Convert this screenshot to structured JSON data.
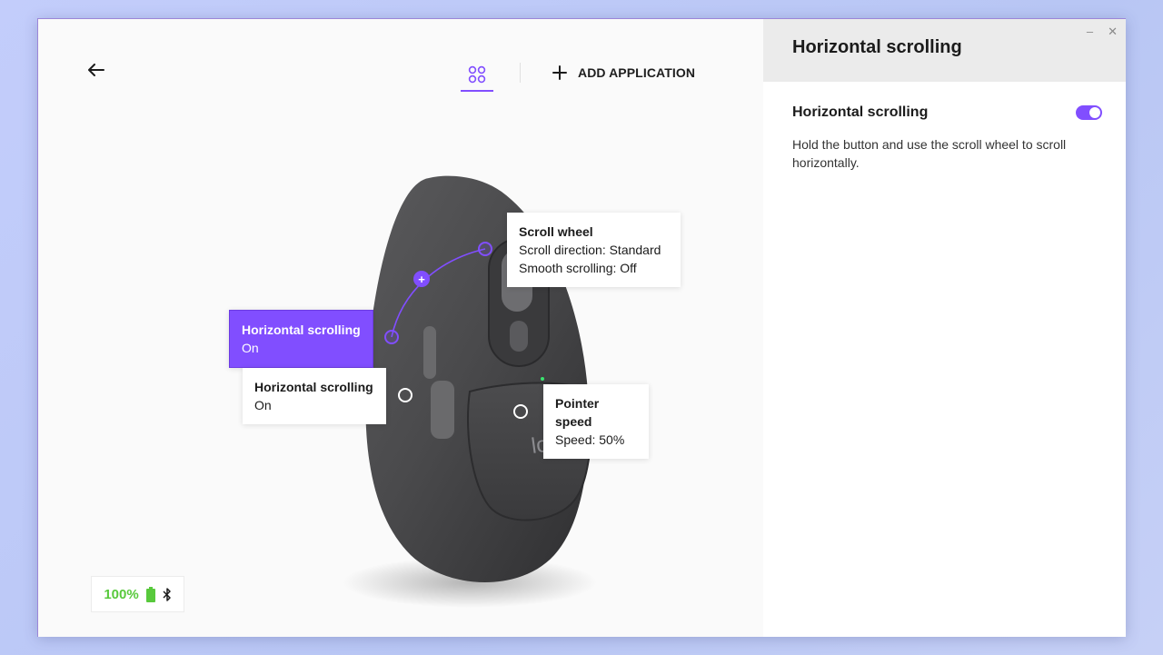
{
  "canvas": {
    "back_icon": "arrow-left-icon",
    "apps_tab_icon": "four-circles-grid-icon",
    "add_application_label": "ADD APPLICATION",
    "device_brand": "logi"
  },
  "callouts": {
    "scroll_wheel": {
      "title": "Scroll wheel",
      "line1": "Scroll direction: Standard",
      "line2": "Smooth scrolling: Off"
    },
    "horizontal_top": {
      "title": "Horizontal scrolling",
      "state": "On"
    },
    "horizontal_bottom": {
      "title": "Horizontal scrolling",
      "state": "On"
    },
    "pointer_speed": {
      "title": "Pointer speed",
      "line1": "Speed: 50%"
    },
    "plus_symbol": "+"
  },
  "battery": {
    "level_text": "100%",
    "battery_icon": "battery-full-icon",
    "connection_icon": "bluetooth-icon"
  },
  "panel": {
    "header_title": "Horizontal scrolling",
    "minimize_symbol": "–",
    "close_symbol": "✕",
    "setting_title": "Horizontal scrolling",
    "toggle_on": true,
    "description": "Hold the button and use the scroll wheel to scroll horizontally."
  },
  "colors": {
    "accent": "#814eff",
    "battery_green": "#58c93c"
  }
}
